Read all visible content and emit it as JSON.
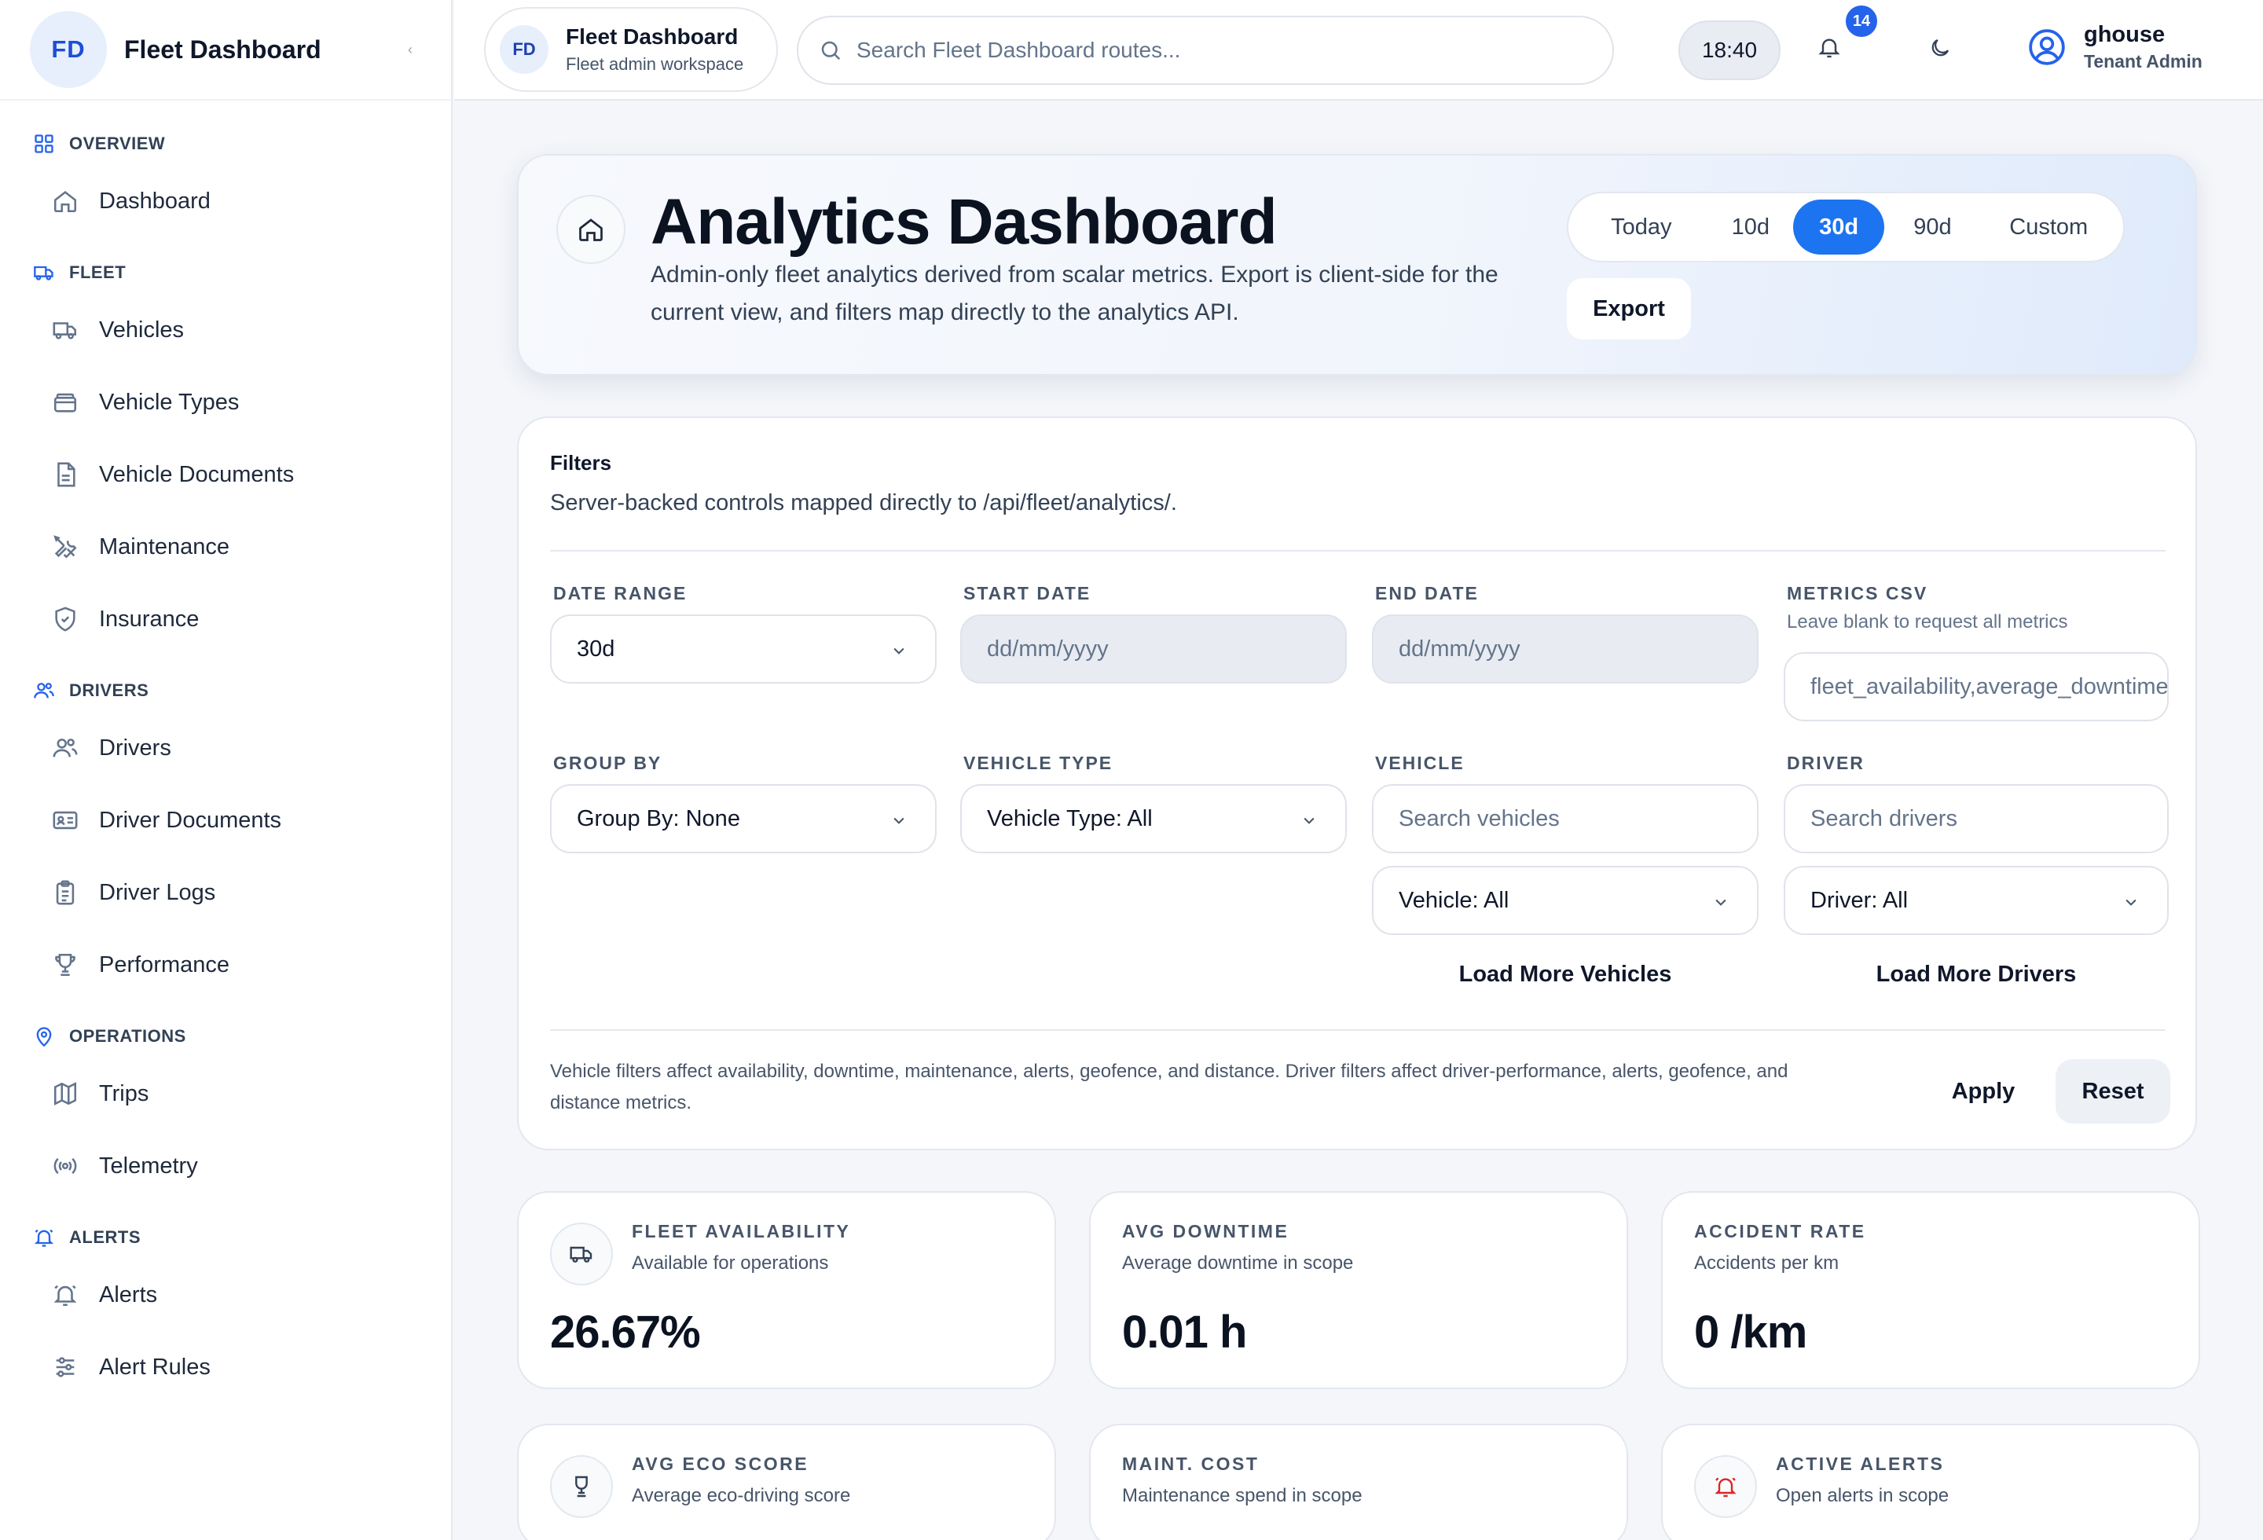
{
  "sidebar": {
    "brand_initials": "FD",
    "brand_name": "Fleet Dashboard",
    "collapse_glyph": "‹",
    "sections": [
      {
        "title": "OVERVIEW",
        "icon": "grid-icon",
        "items": [
          {
            "label": "Dashboard",
            "icon": "home-icon"
          }
        ]
      },
      {
        "title": "FLEET",
        "icon": "truck-icon",
        "items": [
          {
            "label": "Vehicles",
            "icon": "truck-icon"
          },
          {
            "label": "Vehicle Types",
            "icon": "layers-icon"
          },
          {
            "label": "Vehicle Documents",
            "icon": "file-icon"
          },
          {
            "label": "Maintenance",
            "icon": "wrench-icon"
          },
          {
            "label": "Insurance",
            "icon": "shield-icon"
          }
        ]
      },
      {
        "title": "DRIVERS",
        "icon": "users-icon",
        "items": [
          {
            "label": "Drivers",
            "icon": "users-icon"
          },
          {
            "label": "Driver Documents",
            "icon": "id-card-icon"
          },
          {
            "label": "Driver Logs",
            "icon": "clipboard-icon"
          },
          {
            "label": "Performance",
            "icon": "trophy-icon"
          }
        ]
      },
      {
        "title": "OPERATIONS",
        "icon": "map-pin-icon",
        "items": [
          {
            "label": "Trips",
            "icon": "map-icon"
          },
          {
            "label": "Telemetry",
            "icon": "radio-icon"
          }
        ]
      },
      {
        "title": "ALERTS",
        "icon": "bell-icon",
        "items": [
          {
            "label": "Alerts",
            "icon": "bell-icon"
          },
          {
            "label": "Alert Rules",
            "icon": "sliders-icon"
          }
        ]
      }
    ]
  },
  "topbar": {
    "workspace_initials": "FD",
    "workspace_title": "Fleet Dashboard",
    "workspace_subtitle": "Fleet admin workspace",
    "search_placeholder": "Search Fleet Dashboard routes...",
    "clock": "18:40",
    "notification_count": "14",
    "user_name": "ghouse",
    "user_role": "Tenant Admin"
  },
  "hero": {
    "title": "Analytics Dashboard",
    "subtitle": "Admin-only fleet analytics derived from scalar metrics. Export is client-side for the current view, and filters map directly to the analytics API.",
    "ranges": [
      "Today",
      "10d",
      "30d",
      "90d",
      "Custom"
    ],
    "active_range": "30d",
    "export_label": "Export"
  },
  "filters": {
    "title": "Filters",
    "subtitle": "Server-backed controls mapped directly to /api/fleet/analytics/.",
    "date_range_label": "DATE RANGE",
    "date_range_value": "30d",
    "start_date_label": "START DATE",
    "start_date_placeholder": "dd/mm/yyyy",
    "end_date_label": "END DATE",
    "end_date_placeholder": "dd/mm/yyyy",
    "metrics_label": "METRICS CSV",
    "metrics_hint": "Leave blank to request all metrics",
    "metrics_value": "fleet_availability,average_downtime",
    "group_by_label": "GROUP BY",
    "group_by_value": "Group By: None",
    "vehicle_type_label": "VEHICLE TYPE",
    "vehicle_type_value": "Vehicle Type: All",
    "vehicle_label": "VEHICLE",
    "vehicle_search_placeholder": "Search vehicles",
    "vehicle_value": "Vehicle: All",
    "load_more_vehicles": "Load More Vehicles",
    "driver_label": "DRIVER",
    "driver_search_placeholder": "Search drivers",
    "driver_value": "Driver: All",
    "load_more_drivers": "Load More Drivers",
    "note": "Vehicle filters affect availability, downtime, maintenance, alerts, geofence, and distance. Driver filters affect driver-performance, alerts, geofence, and distance metrics.",
    "apply_label": "Apply",
    "reset_label": "Reset"
  },
  "kpis": [
    {
      "label": "FLEET AVAILABILITY",
      "sub": "Available for operations",
      "value": "26.67%",
      "icon": "truck-icon"
    },
    {
      "label": "AVG DOWNTIME",
      "sub": "Average downtime in scope",
      "value": "0.01 h",
      "icon": ""
    },
    {
      "label": "ACCIDENT RATE",
      "sub": "Accidents per km",
      "value": "0 /km",
      "icon": ""
    },
    {
      "label": "AVG ECO SCORE",
      "sub": "Average eco-driving score",
      "value": "",
      "icon": "trophy-icon"
    },
    {
      "label": "MAINT. COST",
      "sub": "Maintenance spend in scope",
      "value": "",
      "icon": ""
    },
    {
      "label": "ACTIVE ALERTS",
      "sub": "Open alerts in scope",
      "value": "",
      "icon": "bell-icon"
    }
  ],
  "colors": {
    "accent": "#1d74f0",
    "badge": "#2563eb",
    "alert_icon": "#dc2626"
  }
}
